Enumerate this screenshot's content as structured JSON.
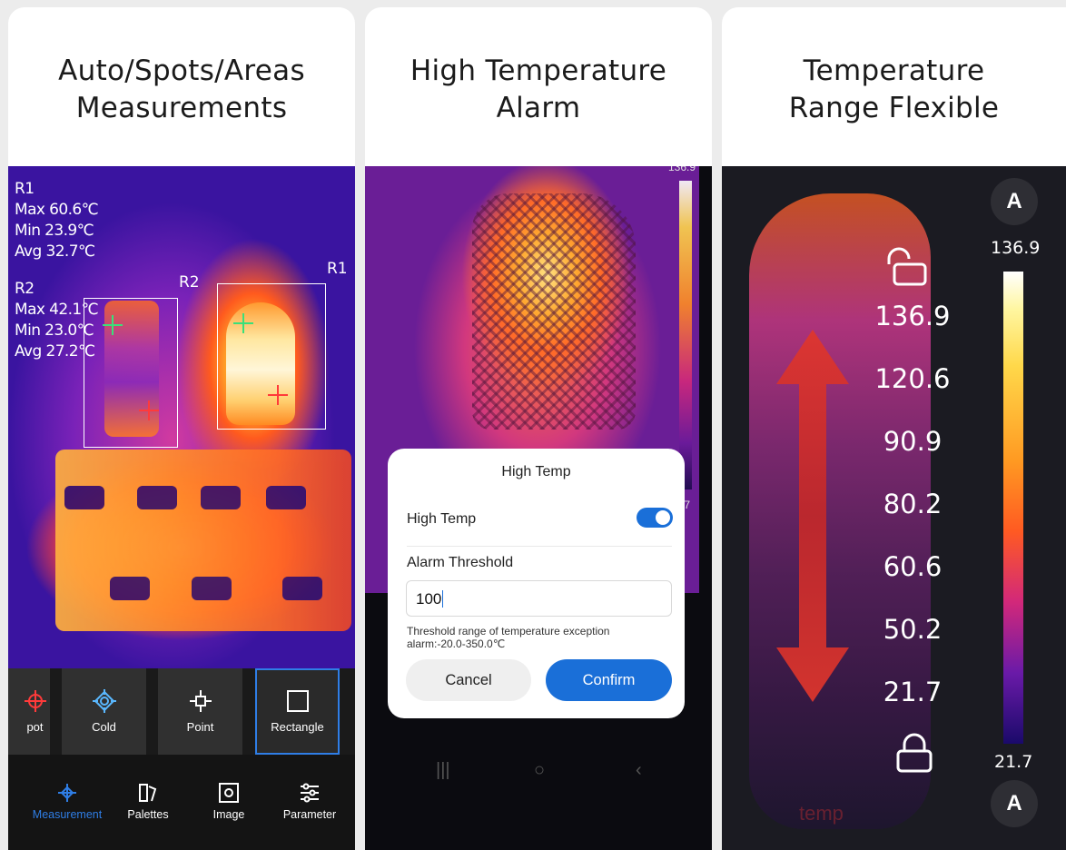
{
  "panel1": {
    "title_line1": "Auto/Spots/Areas",
    "title_line2": "Measurements",
    "r1_readout": {
      "label": "R1",
      "max": "Max  60.6℃",
      "min": "Min  23.9℃",
      "avg": "Avg  32.7℃"
    },
    "r2_readout": {
      "label": "R2",
      "max": "Max  42.1℃",
      "min": "Min  23.0℃",
      "avg": "Avg  27.2℃"
    },
    "rect_labels": {
      "r1": "R1",
      "r2": "R2"
    },
    "tools": [
      {
        "label": "pot",
        "icon": "hot-spot-icon"
      },
      {
        "label": "Cold",
        "icon": "cold-spot-icon"
      },
      {
        "label": "Point",
        "icon": "point-icon"
      },
      {
        "label": "Rectangle",
        "icon": "rectangle-icon"
      }
    ],
    "selected_tool": "Rectangle",
    "nav": [
      {
        "label": "Measurement",
        "icon": "crosshair-icon"
      },
      {
        "label": "Palettes",
        "icon": "palette-icon"
      },
      {
        "label": "Image",
        "icon": "image-icon"
      },
      {
        "label": "Parameter",
        "icon": "sliders-icon"
      }
    ],
    "active_nav": "Measurement",
    "accent": "#2f7ee6"
  },
  "panel2": {
    "title_line1": "High Temperature",
    "title_line2": "Alarm",
    "scale_top": "136.9",
    "scale_bottom": ".7",
    "dialog": {
      "title": "High Temp",
      "toggle_label": "High Temp",
      "toggle_on": true,
      "threshold_label": "Alarm Threshold",
      "threshold_value": "100",
      "hint": "Threshold range of temperature exception alarm:-20.0-350.0℃",
      "cancel": "Cancel",
      "confirm": "Confirm"
    },
    "sysnav": {
      "recents": "|||",
      "home": "○",
      "back": "‹"
    },
    "accent": "#1a6fd8"
  },
  "panel3": {
    "title_line1": "Temperature",
    "title_line2": "Range Flexible",
    "auto_label": "A",
    "scale_max": "136.9",
    "scale_min": "21.7",
    "values": [
      "136.9",
      "120.6",
      "90.9",
      "80.2",
      "60.6",
      "50.2",
      "21.7"
    ],
    "faint_text": "temp"
  }
}
